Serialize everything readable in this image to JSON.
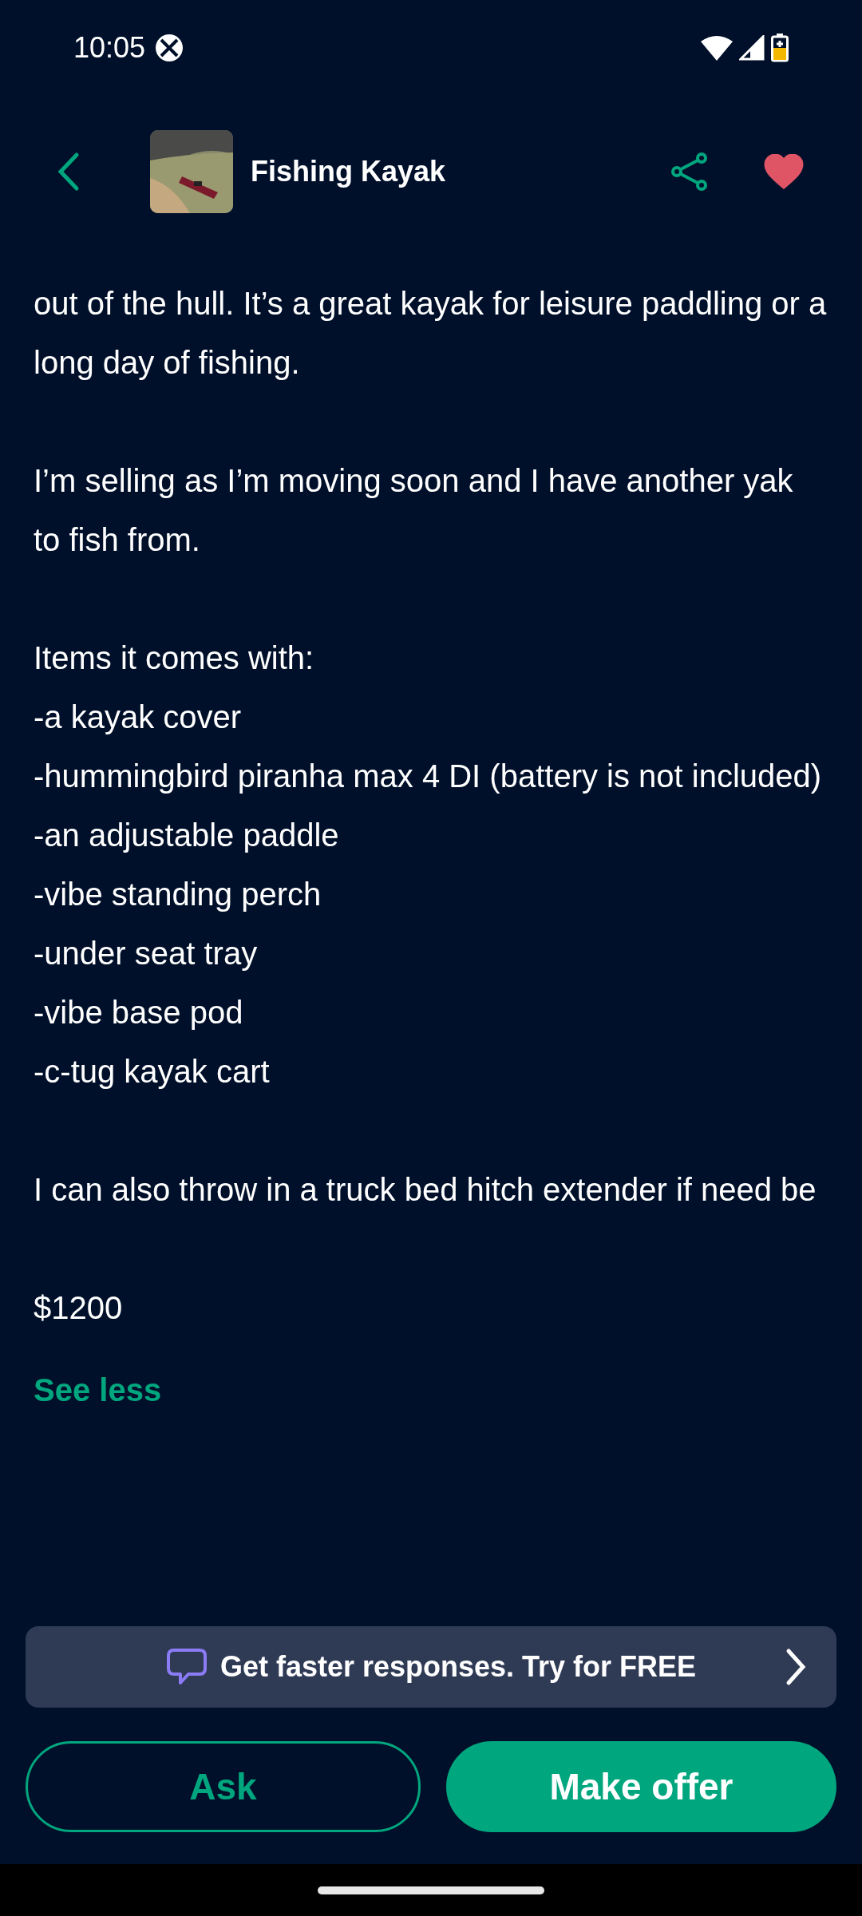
{
  "status_bar": {
    "time": "10:05"
  },
  "header": {
    "title": "Fishing Kayak",
    "favorite": true
  },
  "description": {
    "paragraphs": [
      {
        "lines": [
          "out of the hull. It’s a great kayak for leisure paddling or a long day of fishing."
        ]
      },
      {
        "lines": [
          "I’m selling as I’m moving soon and I have another yak to fish from."
        ]
      },
      {
        "lines": [
          "Items it comes with:",
          "-a kayak cover",
          "-hummingbird piranha max 4 DI (battery is not included)",
          "-an adjustable paddle",
          "-vibe standing perch",
          "-under seat tray",
          "-vibe base pod",
          "-c-tug kayak cart"
        ]
      },
      {
        "lines": [
          "I can also throw in a truck bed hitch extender if need be"
        ]
      },
      {
        "lines": [
          "$1200"
        ]
      }
    ],
    "toggle": "See less"
  },
  "promo_banner": {
    "text": "Get faster responses. Try for FREE"
  },
  "actions": {
    "ask": "Ask",
    "offer": "Make offer"
  }
}
